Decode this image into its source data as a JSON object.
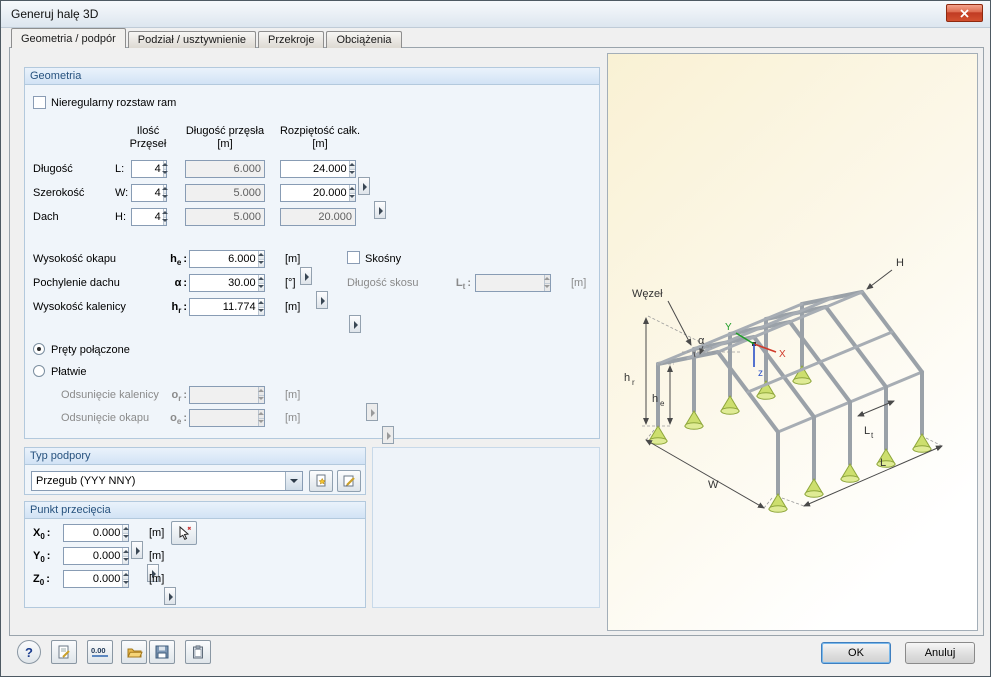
{
  "window": {
    "title": "Generuj halę 3D"
  },
  "labels": {
    "colon": ":"
  },
  "colors": {
    "close_button": "#c03a22",
    "group_header_text": "#27527e",
    "support_cone": "#cddf6e",
    "axis_x": "#d03a2a",
    "axis_y": "#1f9d26",
    "axis_z": "#2a50c8"
  },
  "tabs": [
    {
      "label": "Geometria / podpór"
    },
    {
      "label": "Podział / usztywnienie"
    },
    {
      "label": "Przekroje"
    },
    {
      "label": "Obciążenia"
    }
  ],
  "geometria": {
    "header": "Geometria",
    "irregular": "Nieregularny rozstaw ram",
    "columns": {
      "count_l1": "Ilość",
      "count_l2": "Przęseł",
      "span_l1": "Długość przęsła",
      "span_l2": "[m]",
      "total_l1": "Rozpiętość całk.",
      "total_l2": "[m]"
    },
    "rows": [
      {
        "label": "Długość",
        "sym": "L:",
        "count": "4",
        "span": "6.000",
        "total": "24.000"
      },
      {
        "label": "Szerokość",
        "sym": "W:",
        "count": "4",
        "span": "5.000",
        "total": "20.000"
      },
      {
        "label": "Dach",
        "sym": "H:",
        "count": "4",
        "span": "5.000",
        "total": "20.000"
      }
    ],
    "params": [
      {
        "label": "Wysokość okapu",
        "sym": "h",
        "sub": "e",
        "value": "6.000",
        "unit": "[m]"
      },
      {
        "label": "Pochylenie dachu",
        "sym": "α",
        "sub": "",
        "value": "30.00",
        "unit": "[°]"
      },
      {
        "label": "Wysokość kalenicy",
        "sym": "h",
        "sub": "r",
        "value": "11.774",
        "unit": "[m]"
      }
    ],
    "skosny": "Skośny",
    "skos": {
      "label": "Długość skosu",
      "sym": "L",
      "sub": "t",
      "value": "",
      "unit": "[m]"
    },
    "radio1": "Pręty połączone",
    "radio2": "Płatwie",
    "offsets": [
      {
        "label": "Odsunięcie kalenicy",
        "sym": "o",
        "sub": "r",
        "value": "",
        "unit": "[m]"
      },
      {
        "label": "Odsunięcie okapu",
        "sym": "o",
        "sub": "e",
        "value": "",
        "unit": "[m]"
      }
    ]
  },
  "typ_podpory": {
    "header": "Typ podpory",
    "value": "Przegub (YYY NNY)"
  },
  "punkt": {
    "header": "Punkt przecięcia",
    "rows": [
      {
        "sym": "X",
        "sub": "0",
        "value": "0.000",
        "unit": "[m]"
      },
      {
        "sym": "Y",
        "sub": "0",
        "value": "0.000",
        "unit": "[m]"
      },
      {
        "sym": "Z",
        "sub": "0",
        "value": "0.000",
        "unit": "[m]"
      }
    ]
  },
  "illustration": {
    "node_label": "Węzeł",
    "H": "H",
    "hr": "h",
    "hr_sub": "r",
    "he": "h",
    "he_sub": "e",
    "alpha": "α",
    "Lt": "L",
    "Lt_sub": "t",
    "L": "L",
    "W": "W",
    "axis_x": "X",
    "axis_y": "Y",
    "axis_z": "z"
  },
  "toolbar": {
    "help": "?",
    "units": "0.00"
  },
  "buttons": {
    "ok": "OK",
    "cancel": "Anuluj"
  }
}
